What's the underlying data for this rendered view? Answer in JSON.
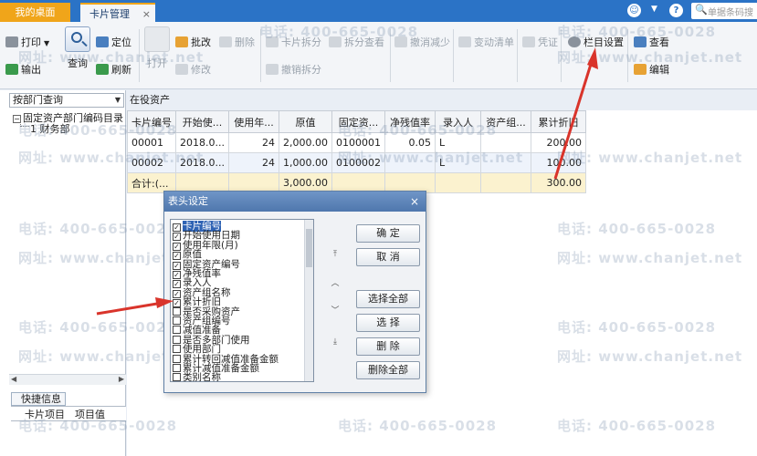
{
  "tabs": {
    "home": "我的桌面",
    "card": "卡片管理",
    "close": "×"
  },
  "topright": {
    "search_placeholder": "单据条码搜"
  },
  "toolbar": {
    "print": "打印",
    "export": "输出",
    "query": "查询",
    "locate": "定位",
    "refresh": "刷新",
    "open": "打开",
    "batch_change": "批改",
    "modify": "修改",
    "delete": "删除",
    "card_split": "卡片拆分",
    "split_view": "拆分查看",
    "undo_split": "撤销拆分",
    "cancel_reduce": "撤消减少",
    "change_list": "变动清单",
    "voucher": "凭证",
    "column_settings": "栏目设置",
    "view": "查看",
    "edit": "编辑"
  },
  "left": {
    "dept_query": "按部门查询",
    "tree_root": "固定资产部门编码目录",
    "tree_child": "1 财务部",
    "quick_info": "快捷信息",
    "quick_col1": "卡片项目",
    "quick_col2": "项目值"
  },
  "main": {
    "breadcrumb": "在役资产",
    "columns": [
      "卡片编号",
      "开始使...",
      "使用年...",
      "原值",
      "固定资...",
      "净残值率",
      "录入人",
      "资产组...",
      "累计折旧"
    ],
    "rows": [
      [
        "00001",
        "2018.0...",
        "24",
        "2,000.00",
        "0100001",
        "0.05",
        "L",
        "",
        "200.00"
      ],
      [
        "00002",
        "2018.0...",
        "24",
        "1,000.00",
        "0100002",
        "",
        "L",
        "",
        "100.00"
      ]
    ],
    "sum_row": [
      "合计:(...",
      "",
      "",
      "3,000.00",
      "",
      "",
      "",
      "",
      "300.00"
    ]
  },
  "dialog": {
    "title": "表头设定",
    "close": "×",
    "fields": [
      {
        "label": "卡片编号",
        "checked": true,
        "selected": true
      },
      {
        "label": "开始使用日期",
        "checked": true
      },
      {
        "label": "使用年限(月)",
        "checked": true
      },
      {
        "label": "原值",
        "checked": true
      },
      {
        "label": "固定资产编号",
        "checked": true
      },
      {
        "label": "净残值率",
        "checked": true
      },
      {
        "label": "录入人",
        "checked": true
      },
      {
        "label": "资产组名称",
        "checked": true
      },
      {
        "label": "累计折旧",
        "checked": true
      },
      {
        "label": "是否采购资产",
        "checked": false
      },
      {
        "label": "资产组编号",
        "checked": false
      },
      {
        "label": "减值准备",
        "checked": false
      },
      {
        "label": "是否多部门使用",
        "checked": false
      },
      {
        "label": "使用部门",
        "checked": false
      },
      {
        "label": "累计转回减值准备金额",
        "checked": false
      },
      {
        "label": "累计减值准备金额",
        "checked": false
      },
      {
        "label": "类别名称",
        "checked": false
      }
    ],
    "btn_ok": "确  定",
    "btn_cancel": "取  消",
    "btn_select_all": "选择全部",
    "btn_select": "选  择",
    "btn_delete": "删  除",
    "btn_delete_all": "删除全部"
  },
  "watermark": {
    "phone": "电话: 400-665-0028",
    "url": "网址: www.chanjet.net"
  },
  "colors": {
    "titlebar_blue": "#2b73c6",
    "home_tab_orange": "#f0a51a",
    "arrow_red": "#d9342b",
    "selection_blue": "#2f63b4",
    "sum_row_yellow": "#fbf2cf"
  }
}
